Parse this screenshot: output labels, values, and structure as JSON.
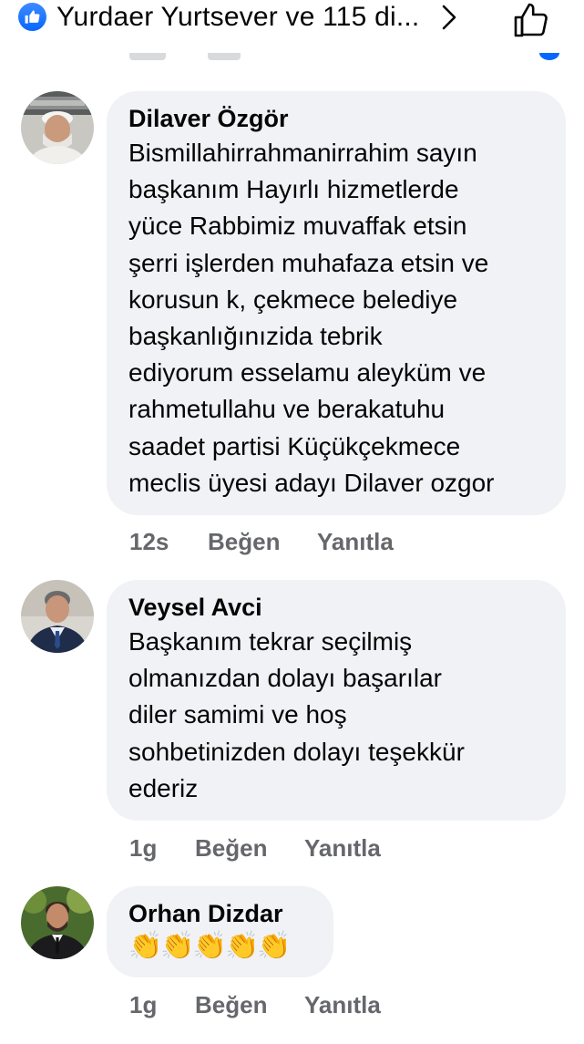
{
  "header": {
    "reactors_text": "Yurdaer Yurtsever ve 115 di...",
    "colors": {
      "like_blue": "#0866ff",
      "text": "#050505",
      "muted": "#65676b",
      "bubble": "#f0f2f5"
    },
    "icons": [
      "like-badge-icon",
      "chevron-right-icon",
      "thumbs-up-outline-icon"
    ]
  },
  "comments": [
    {
      "author": "Dilaver Özgör",
      "text": "Bismillahirrahmanirrahim sayın\nbaşkanım Hayırlı hizmetlerde\nyüce Rabbimiz muvaffak etsin\nşerri işlerden muhafaza etsin ve\nkorusun k, çekmece belediye\nbaşkanlığınızida tebrik\nediyorum esselamu aleyküm ve\nrahmetullahu ve berakatuhu\nsaadet partisi Küçükçekmece\nmeclis üyesi adayı Dilaver ozgor",
      "time": "12s",
      "like_label": "Beğen",
      "reply_label": "Yanıtla"
    },
    {
      "author": "Veysel Avci",
      "text": "Başkanım tekrar seçilmiş\nolmanızdan dolayı başarılar\ndiler samimi ve hoş\nsohbetinizden dolayı teşekkür\nederiz",
      "time": "1g",
      "like_label": "Beğen",
      "reply_label": "Yanıtla"
    },
    {
      "author": "Orhan Dizdar",
      "text": "👏👏👏👏👏",
      "time": "1g",
      "like_label": "Beğen",
      "reply_label": "Yanıtla"
    }
  ]
}
